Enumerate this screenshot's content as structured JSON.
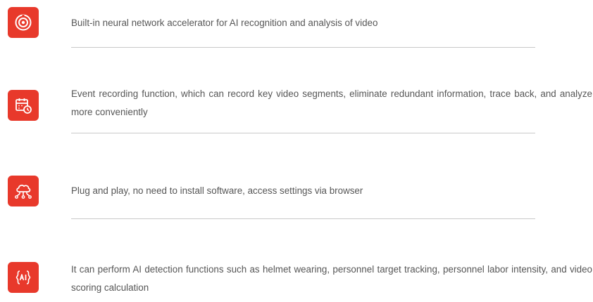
{
  "features": [
    {
      "icon": "target-icon",
      "text": "Built-in neural network accelerator for AI recognition and analysis of video"
    },
    {
      "icon": "calendar-clock-icon",
      "text": "Event recording function, which can record key video segments, eliminate redundant information, trace back, and analyze more conveniently"
    },
    {
      "icon": "cloud-network-icon",
      "text": "Plug and play, no need to install software, access settings via browser"
    },
    {
      "icon": "ai-chip-icon",
      "text": "It can perform AI detection functions such as helmet wearing, personnel target tracking, personnel labor intensity, and video scoring calculation"
    }
  ],
  "colors": {
    "accent": "#e8392b",
    "text": "#565656",
    "divider": "#c9c9c9"
  }
}
